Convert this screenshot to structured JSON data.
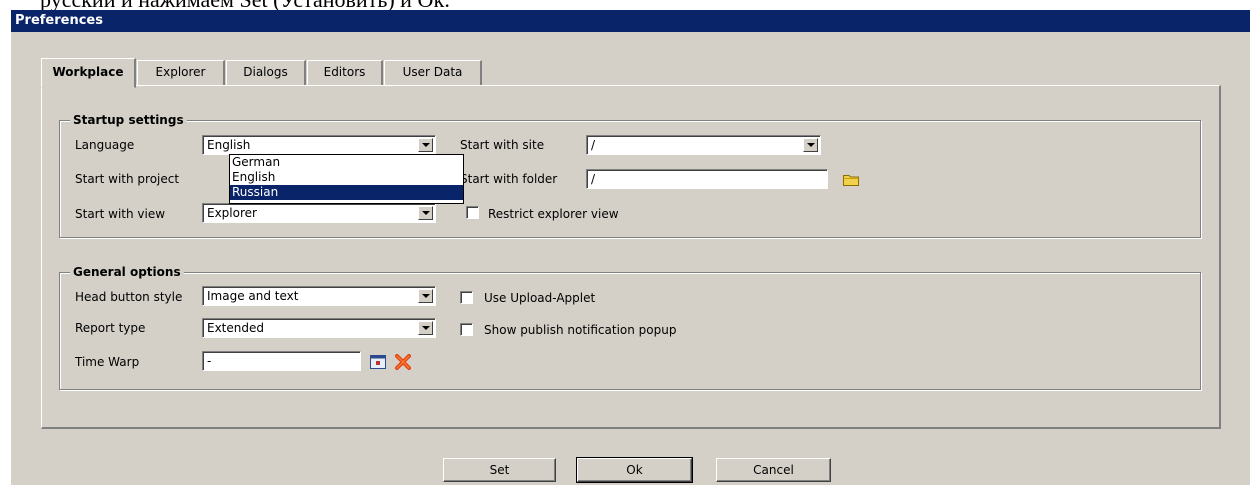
{
  "caption": "русский и нажимаем Set (Установить) и Ok.",
  "window": {
    "title": "Preferences"
  },
  "tabs": [
    {
      "label": "Workplace",
      "active": true
    },
    {
      "label": "Explorer",
      "active": false
    },
    {
      "label": "Dialogs",
      "active": false
    },
    {
      "label": "Editors",
      "active": false
    },
    {
      "label": "User Data",
      "active": false
    }
  ],
  "startup": {
    "legend": "Startup settings",
    "language": {
      "label": "Language",
      "value": "English",
      "options": [
        "German",
        "English",
        "Russian"
      ],
      "highlighted": "Russian"
    },
    "project": {
      "label": "Start with project"
    },
    "view": {
      "label": "Start with view",
      "value": "Explorer"
    },
    "site": {
      "label": "Start with site",
      "value": "/"
    },
    "folder": {
      "label": "Start with folder",
      "value": "/"
    },
    "restrict": {
      "label": "Restrict explorer view",
      "checked": false
    }
  },
  "general": {
    "legend": "General options",
    "head_button": {
      "label": "Head button style",
      "value": "Image and text"
    },
    "report_type": {
      "label": "Report type",
      "value": "Extended"
    },
    "time_warp": {
      "label": "Time Warp",
      "value": "-"
    },
    "upload_applet": {
      "label": "Use Upload-Applet",
      "checked": false
    },
    "publish_popup": {
      "label": "Show publish notification popup",
      "checked": false
    }
  },
  "buttons": {
    "set": "Set",
    "ok": "Ok",
    "cancel": "Cancel"
  }
}
